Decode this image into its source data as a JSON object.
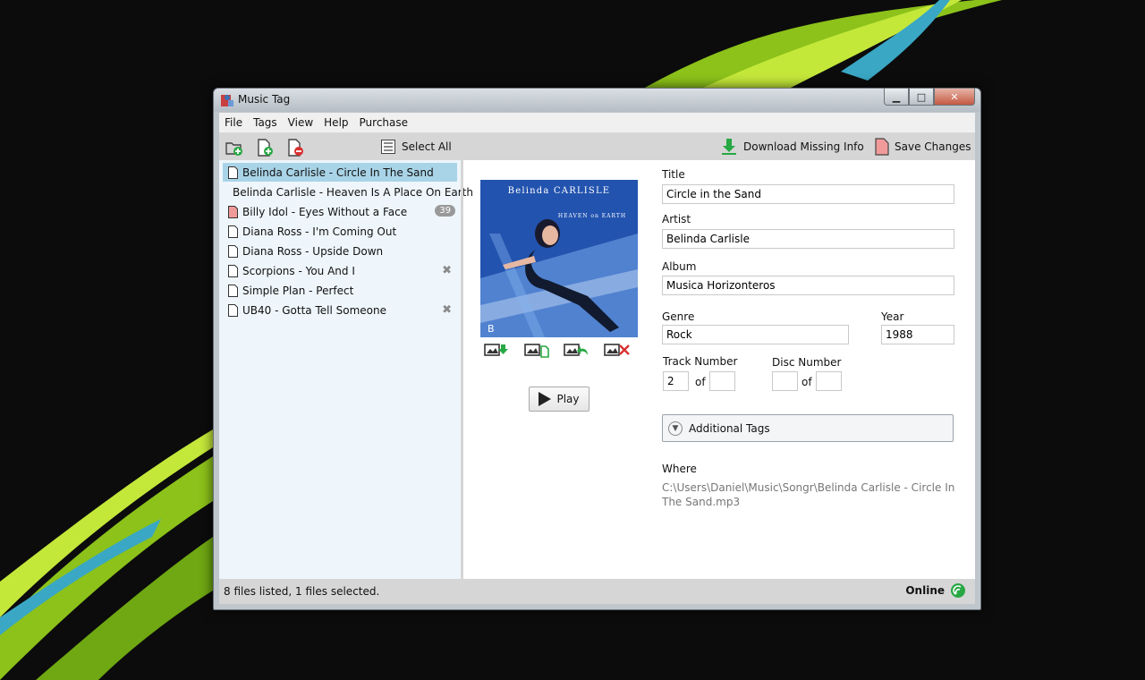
{
  "window": {
    "title": "Music Tag"
  },
  "menu": [
    "File",
    "Tags",
    "View",
    "Help",
    "Purchase"
  ],
  "left_toolbar": {
    "select_all_label": "Select All"
  },
  "right_toolbar": {
    "download_label": "Download Missing Info",
    "save_label": "Save Changes"
  },
  "files": [
    {
      "name": "Belinda Carlisle - Circle In The Sand",
      "selected": true
    },
    {
      "name": "Belinda Carlisle - Heaven Is A Place On Earth"
    },
    {
      "name": "Billy Idol - Eyes Without a Face",
      "badge": "39",
      "modified": true
    },
    {
      "name": "Diana Ross - I'm Coming Out"
    },
    {
      "name": "Diana Ross - Upside Down"
    },
    {
      "name": "Scorpions - You And I",
      "removable": true
    },
    {
      "name": "Simple Plan - Perfect"
    },
    {
      "name": "UB40 - Gotta Tell Someone",
      "removable": true
    }
  ],
  "album_art": {
    "artist_text": "Belinda CARLISLE",
    "album_text": "HEAVEN on EARTH",
    "corner_letter": "B"
  },
  "player": {
    "play_label": "Play"
  },
  "fields": {
    "title_label": "Title",
    "title_value": "Circle in the Sand",
    "artist_label": "Artist",
    "artist_value": "Belinda Carlisle",
    "album_label": "Album",
    "album_value": "Musica Horizonteros",
    "genre_label": "Genre",
    "genre_value": "Rock",
    "year_label": "Year",
    "year_value": "1988",
    "track_label": "Track Number",
    "track_value": "2",
    "track_total": "",
    "disc_label": "Disc Number",
    "disc_value": "",
    "disc_total": "",
    "of_label": "of"
  },
  "additional_tags_label": "Additional Tags",
  "where": {
    "label": "Where",
    "path": "C:\\Users\\Daniel\\Music\\Songr\\Belinda Carlisle - Circle In The Sand.mp3"
  },
  "status": {
    "text": "8 files listed,  1 files selected.",
    "online_label": "Online"
  },
  "colors": {
    "accent_green": "#27a844",
    "selection_blue": "#a9d4e8",
    "list_bg": "#eef6fb",
    "toolbar_gray": "#d6d6d6",
    "wallpaper_lime": "#a8d420"
  }
}
